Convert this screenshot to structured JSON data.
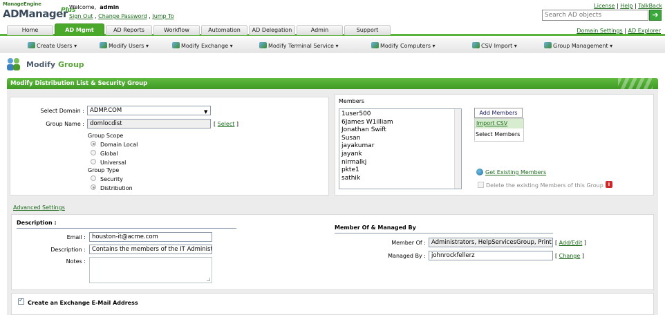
{
  "header": {
    "logo_sub": "ManageEngine",
    "logo_main": "ADManager",
    "logo_plus": "Plus",
    "welcome_prefix": "Welcome,",
    "username": "admin",
    "links": {
      "sign_out": "Sign Out",
      "change_password": "Change Password",
      "jump_to": "Jump To"
    },
    "right_links": {
      "license": "License",
      "help": "Help",
      "talkback": "TalkBack"
    },
    "search_placeholder": "Search AD objects"
  },
  "tabs": [
    "Home",
    "AD Mgmt",
    "AD Reports",
    "Workflow",
    "Automation",
    "AD Delegation",
    "Admin",
    "Support"
  ],
  "active_tab": "AD Mgmt",
  "domain_links": {
    "domain_settings": "Domain Settings",
    "ad_explorer": "AD Explorer"
  },
  "subnav": [
    "Create Users ▾",
    "Modify Users ▾",
    "Modify Exchange ▾",
    "Modify Terminal Service ▾",
    "Modify Computers ▾",
    "CSV Import ▾",
    "Group Management ▾"
  ],
  "page_title": {
    "part1": "Modify",
    "part2": "Group"
  },
  "section_header": "Modify Distribution List & Security Group",
  "form": {
    "select_domain_label": "Select Domain :",
    "domain_value": "ADMP.COM",
    "group_name_label": "Group Name :",
    "group_name_value": "domlocdist",
    "select_link": "Select",
    "group_scope_label": "Group Scope",
    "scope_options": [
      "Domain Local",
      "Global",
      "Universal"
    ],
    "group_type_label": "Group Type",
    "type_options": [
      "Security",
      "Distribution"
    ]
  },
  "members": {
    "label": "Members",
    "list": [
      "1user500",
      "6James W1illiam",
      "Jonathan Swift",
      "Susan",
      "jayakumar",
      "jayank",
      "nirmalkj",
      "pkte1",
      "sathik"
    ],
    "add_button": "Add Members",
    "import_csv": "Import CSV",
    "select_members": "Select Members",
    "get_existing": "Get Existing Members",
    "delete_existing": "Delete the existing Members of this Group",
    "badge": "i"
  },
  "advanced_settings": "Advanced Settings",
  "description_section": {
    "title": "Description :",
    "email_label": "Email :",
    "email_value": "houston-it@acme.com",
    "description_label": "Description :",
    "description_value": "Contains the members of the IT Administra",
    "notes_label": "Notes :"
  },
  "member_of_section": {
    "title": "Member Of & Managed By",
    "member_of_label": "Member Of :",
    "member_of_value": "Administrators, HelpServicesGroup, Print O",
    "add_edit_link": "Add/Edit",
    "managed_by_label": "Managed By :",
    "managed_by_value": "johnrockfellerz",
    "change_link": "Change"
  },
  "exchange": {
    "label": "Create an Exchange E-Mail Address"
  }
}
